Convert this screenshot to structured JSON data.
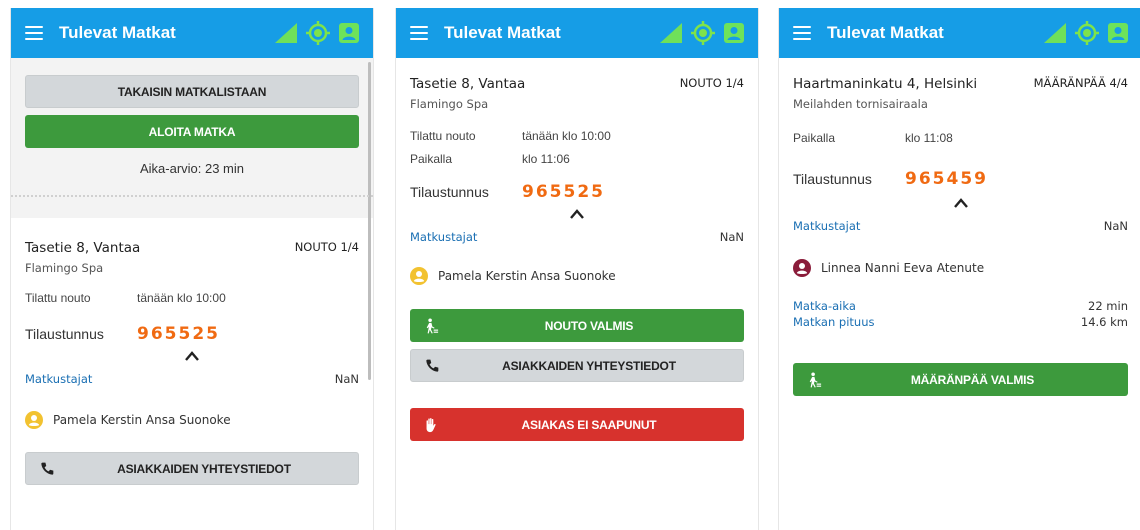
{
  "app": {
    "title": "Tulevat Matkat",
    "colors": {
      "appbar": "#169de6",
      "signal": "#6fe05a",
      "gps": "#7fe34a",
      "contact": "#6ee25a",
      "green_button": "#3d9a3d",
      "red_button": "#d7322d",
      "order_number": "#f06a12",
      "link_blue": "#1a6fb3"
    },
    "icons": [
      "menu-icon",
      "signal-icon",
      "gps-icon",
      "contact-card-icon",
      "phone-icon",
      "walking-person-icon",
      "hand-stop-icon",
      "person-icon",
      "chevron-up-icon"
    ]
  },
  "screen1": {
    "back_button": "TAKAISIN MATKALISTAAN",
    "start_button": "ALOITA MATKA",
    "estimate": "Aika-arvio: 23 min",
    "address": "Tasetie 8, Vantaa",
    "place": "Flamingo Spa",
    "stage": "NOUTO 1/4",
    "ordered_pickup_label": "Tilattu nouto",
    "ordered_pickup_value": "tänään klo 10:00",
    "order_label": "Tilaustunnus",
    "order_number": "965525",
    "passengers_label": "Matkustajat",
    "passengers_value": "NaN",
    "passenger_name": "Pamela Kerstin Ansa Suonoke",
    "contact_button": "ASIAKKAIDEN YHTEYSTIEDOT"
  },
  "screen2": {
    "address": "Tasetie 8, Vantaa",
    "place": "Flamingo Spa",
    "stage": "NOUTO 1/4",
    "ordered_pickup_label": "Tilattu nouto",
    "ordered_pickup_value": "tänään klo 10:00",
    "on_site_label": "Paikalla",
    "on_site_value": "klo 11:06",
    "order_label": "Tilaustunnus",
    "order_number": "965525",
    "passengers_label": "Matkustajat",
    "passengers_value": "NaN",
    "passenger_name": "Pamela Kerstin Ansa Suonoke",
    "pickup_done_button": "NOUTO VALMIS",
    "contact_button": "ASIAKKAIDEN YHTEYSTIEDOT",
    "no_show_button": "ASIAKAS EI SAAPUNUT"
  },
  "screen3": {
    "address": "Haartmaninkatu 4, Helsinki",
    "place": "Meilahden tornisairaala",
    "stage": "MÄÄRÄNPÄÄ 4/4",
    "on_site_label": "Paikalla",
    "on_site_value": "klo 11:08",
    "order_label": "Tilaustunnus",
    "order_number": "965459",
    "passengers_label": "Matkustajat",
    "passengers_value": "NaN",
    "passenger_name": "Linnea Nanni Eeva Atenute",
    "trip_time_label": "Matka-aika",
    "trip_time_value": "22 min",
    "trip_length_label": "Matkan pituus",
    "trip_length_value": "14.6 km",
    "destination_done_button": "MÄÄRÄNPÄÄ VALMIS"
  }
}
